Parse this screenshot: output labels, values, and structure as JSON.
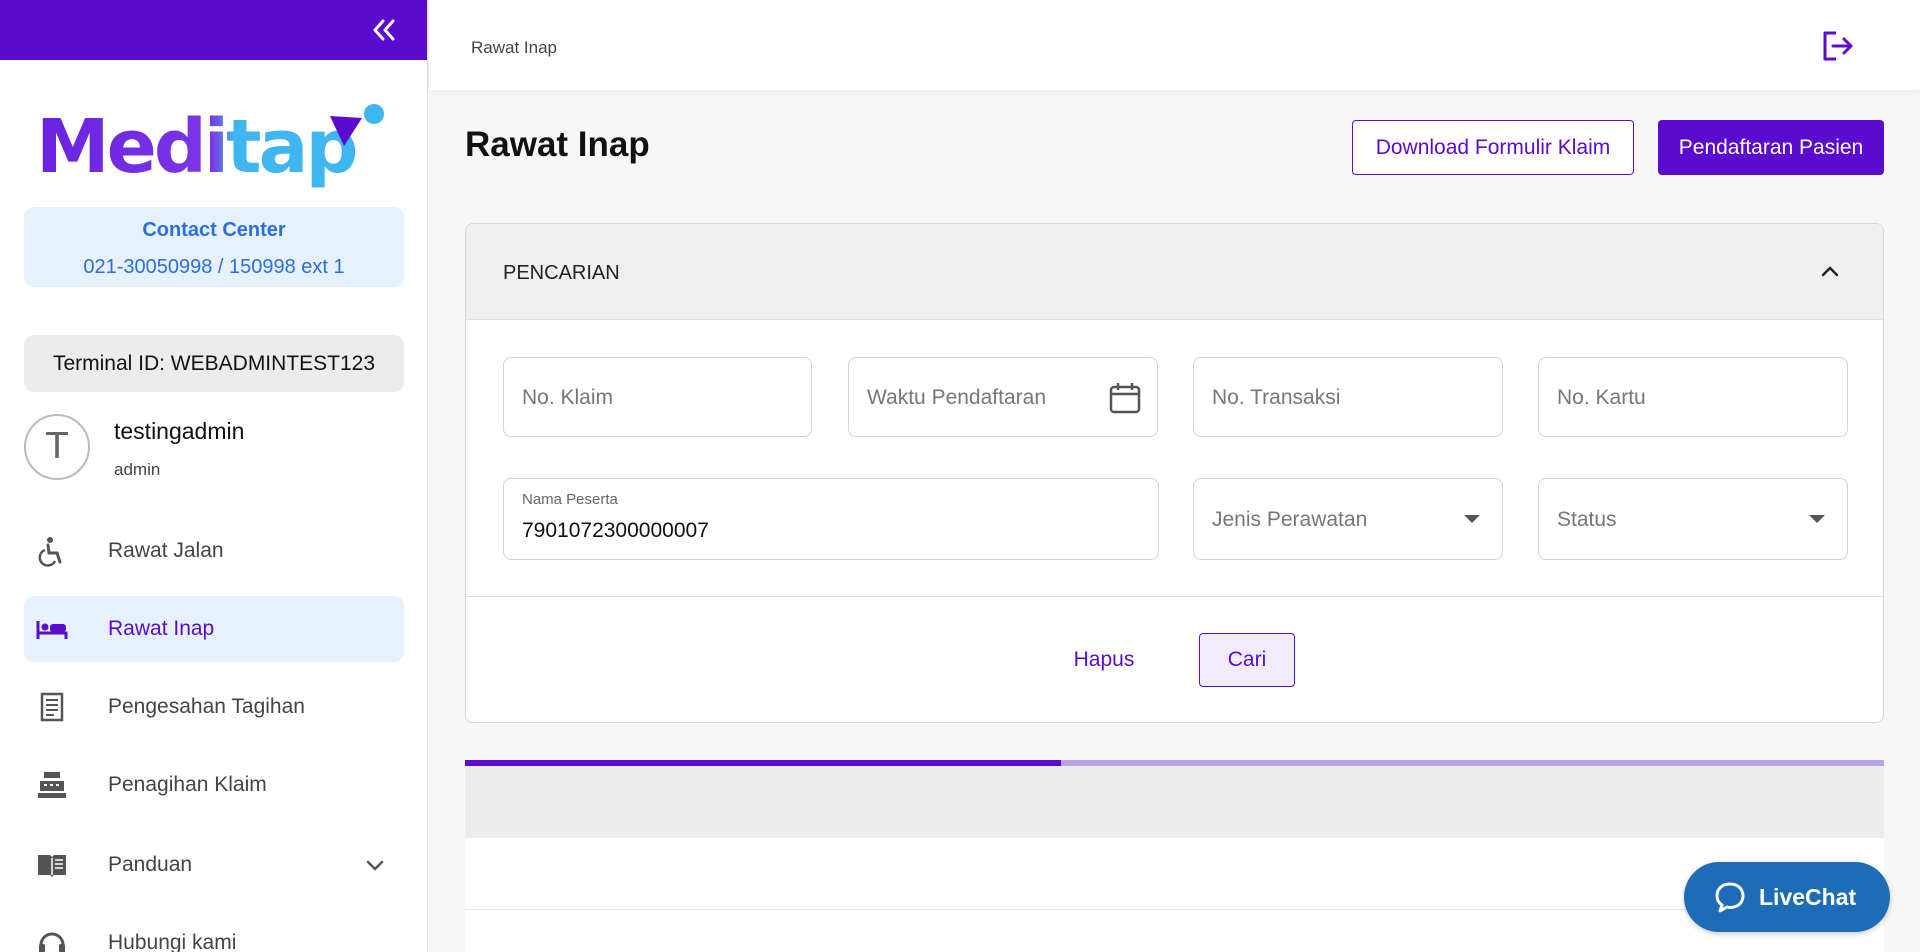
{
  "sidebar": {
    "logo_text": "Meditap",
    "contact_center": {
      "title": "Contact Center",
      "phone": "021-30050998 / 150998 ext 1"
    },
    "terminal_id": "Terminal ID: WEBADMINTEST123",
    "user": {
      "initial": "T",
      "name": "testingadmin",
      "role": "admin"
    },
    "items": [
      {
        "label": "Rawat Jalan",
        "icon": "wheelchair-icon",
        "active": false
      },
      {
        "label": "Rawat Inap",
        "icon": "bed-icon",
        "active": true
      },
      {
        "label": "Pengesahan Tagihan",
        "icon": "receipt-icon",
        "active": false
      },
      {
        "label": "Penagihan Klaim",
        "icon": "cash-register-icon",
        "active": false
      },
      {
        "label": "Panduan",
        "icon": "book-icon",
        "active": false
      },
      {
        "label": "Hubungi kami",
        "icon": "headset-icon",
        "active": false
      }
    ]
  },
  "header": {
    "breadcrumb": "Rawat Inap"
  },
  "main": {
    "title": "Rawat Inap",
    "download_button": "Download Formulir Klaim",
    "register_button": "Pendaftaran Pasien",
    "search": {
      "header": "PENCARIAN",
      "fields": {
        "no_klaim": "No. Klaim",
        "waktu_pendaftaran": "Waktu Pendaftaran",
        "no_transaksi": "No. Transaksi",
        "no_kartu": "No. Kartu",
        "nama_peserta_label": "Nama Peserta",
        "nama_peserta_value": "7901072300000007",
        "jenis_perawatan": "Jenis Perawatan",
        "status": "Status"
      },
      "clear_button": "Hapus",
      "search_button": "Cari"
    },
    "loading_progress": 0.42
  },
  "livechat": {
    "label": "LiveChat"
  },
  "colors": {
    "brand": "#5b0ad0",
    "accent_blue": "#2a6fe0",
    "livechat": "#1e6cb5"
  }
}
